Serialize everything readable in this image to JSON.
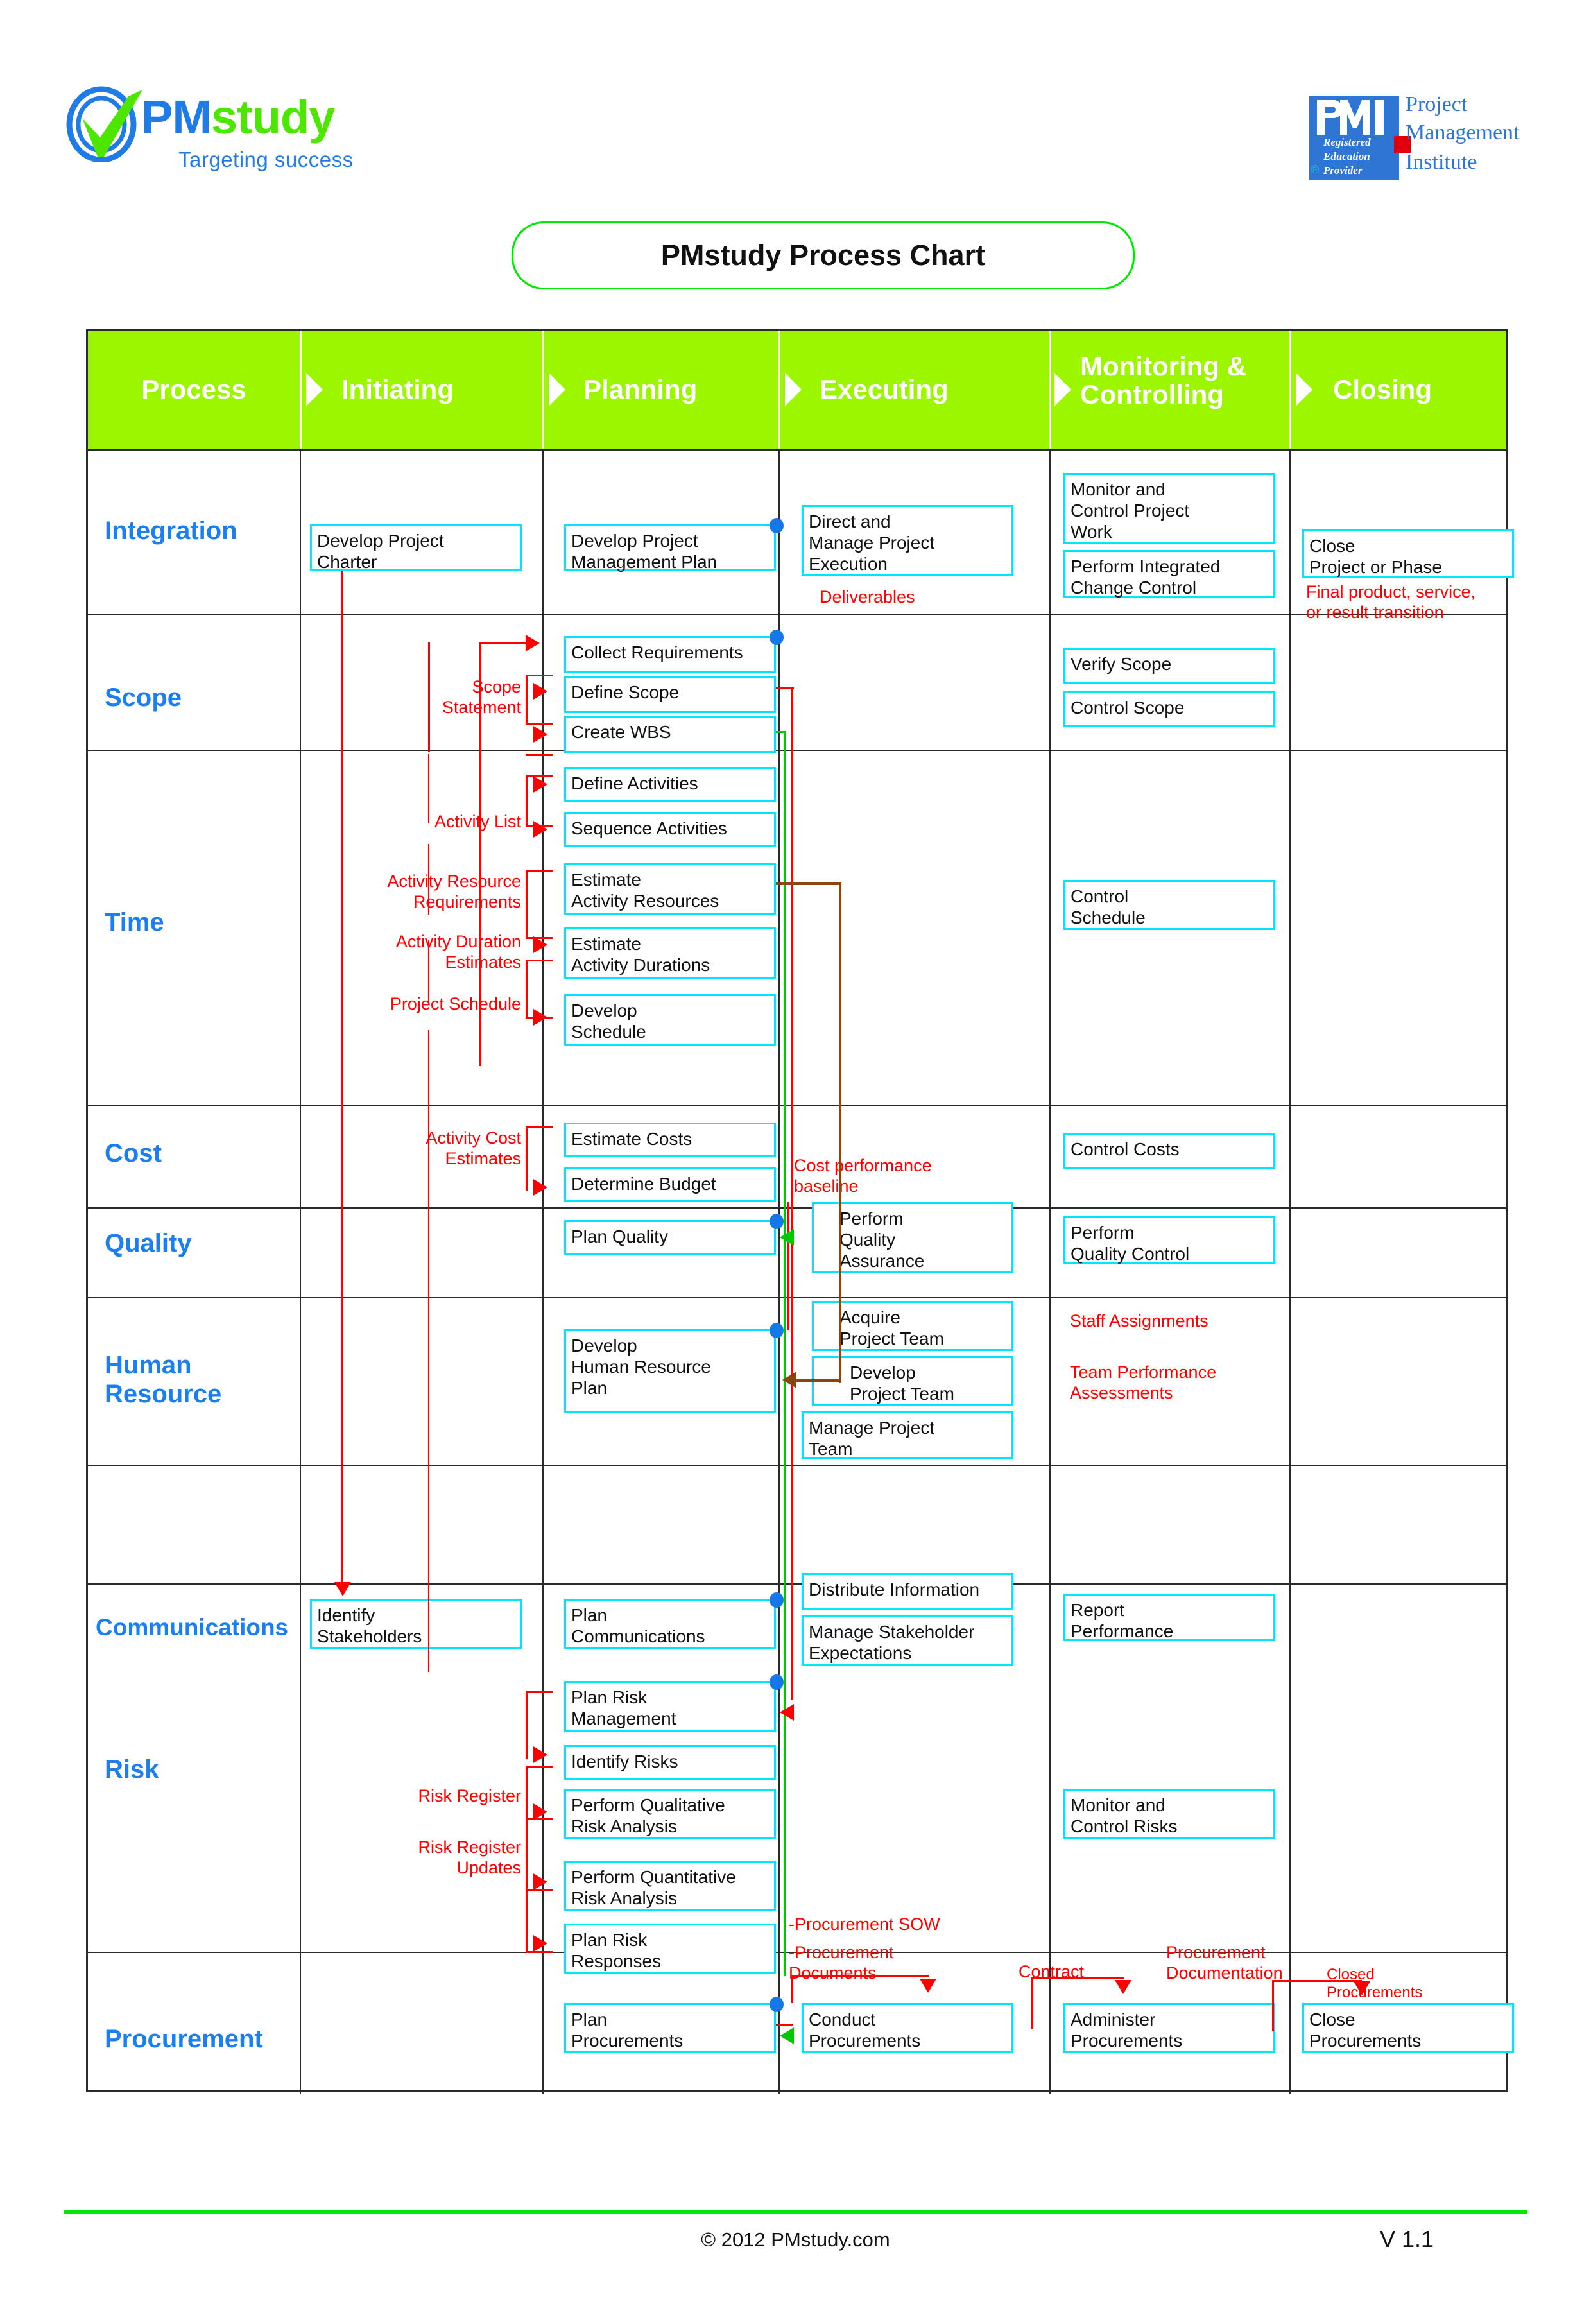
{
  "brand": {
    "logo_word_pm": "PM",
    "logo_word_study": "study",
    "tagline": "Targeting success",
    "pmi_letters": "PMI",
    "pmi_sub_1": "Registered",
    "pmi_sub_2": "Education",
    "pmi_sub_3": "Provider",
    "pmi_reg_mark": "®",
    "pmi_name_1": "Project",
    "pmi_name_2": "Management",
    "pmi_name_3": "Institute"
  },
  "title": "PMstudy Process Chart",
  "colors": {
    "header_green": "#9CF600",
    "box_border": "#00E5FF",
    "row_label_blue": "#1B7FF0",
    "annotation_red": "#FF0000",
    "brand_blue": "#1F7BE5",
    "brand_green": "#4CE600"
  },
  "columns": [
    "Process",
    "Initiating",
    "Planning",
    "Executing",
    "Monitoring & Controlling",
    "Closing"
  ],
  "chart_data": {
    "type": "table",
    "title": "PMstudy Process Chart",
    "columns": [
      "Process",
      "Initiating",
      "Planning",
      "Executing",
      "Monitoring & Controlling",
      "Closing"
    ],
    "rows": [
      {
        "knowledge_area": "Integration",
        "initiating": [
          "Develop Project Charter"
        ],
        "planning": [
          "Develop Project Management Plan"
        ],
        "executing": [
          "Direct and Manage Project Execution"
        ],
        "monitoring": [
          "Monitor and Control Project Work",
          "Perform Integrated Change Control"
        ],
        "closing": [
          "Close Project or Phase"
        ],
        "annotations": [
          "Deliverables",
          "Final product, service, or result transition"
        ]
      },
      {
        "knowledge_area": "Scope",
        "initiating": [],
        "planning": [
          "Collect Requirements",
          "Define Scope",
          "Create WBS"
        ],
        "executing": [],
        "monitoring": [
          "Verify Scope",
          "Control Scope"
        ],
        "closing": [],
        "annotations": [
          "Scope Statement"
        ]
      },
      {
        "knowledge_area": "Time",
        "initiating": [],
        "planning": [
          "Define Activities",
          "Sequence Activities",
          "Estimate Activity Resources",
          "Estimate Activity Durations",
          "Develop Schedule"
        ],
        "executing": [],
        "monitoring": [
          "Control Schedule"
        ],
        "closing": [],
        "annotations": [
          "Activity List",
          "Activity Resource Requirements",
          "Activity Duration Estimates",
          "Project Schedule"
        ]
      },
      {
        "knowledge_area": "Cost",
        "initiating": [],
        "planning": [
          "Estimate Costs",
          "Determine Budget"
        ],
        "executing": [],
        "monitoring": [
          "Control Costs"
        ],
        "closing": [],
        "annotations": [
          "Activity Cost Estimates",
          "Cost performance baseline"
        ]
      },
      {
        "knowledge_area": "Quality",
        "initiating": [],
        "planning": [
          "Plan Quality"
        ],
        "executing": [
          "Perform Quality Assurance"
        ],
        "monitoring": [
          "Perform Quality Control"
        ],
        "closing": [],
        "annotations": []
      },
      {
        "knowledge_area": "Human Resource",
        "initiating": [],
        "planning": [
          "Develop Human Resource Plan"
        ],
        "executing": [
          "Acquire Project Team",
          "Develop Project Team",
          "Manage Project Team"
        ],
        "monitoring": [],
        "closing": [],
        "annotations": [
          "Staff Assignments",
          "Team Performance Assessments"
        ]
      },
      {
        "knowledge_area": "Communications",
        "initiating": [
          "Identify Stakeholders"
        ],
        "planning": [
          "Plan Communications"
        ],
        "executing": [
          "Distribute Information",
          "Manage Stakeholder Expectations"
        ],
        "monitoring": [
          "Report Performance"
        ],
        "closing": [],
        "annotations": []
      },
      {
        "knowledge_area": "Risk",
        "initiating": [],
        "planning": [
          "Plan Risk Management",
          "Identify Risks",
          "Perform Qualitative Risk Analysis",
          "Perform Quantitative Risk Analysis",
          "Plan Risk Responses"
        ],
        "executing": [],
        "monitoring": [
          "Monitor and Control Risks"
        ],
        "closing": [],
        "annotations": [
          "Risk Register",
          "Risk Register Updates"
        ]
      },
      {
        "knowledge_area": "Procurement",
        "initiating": [],
        "planning": [
          "Plan Procurements"
        ],
        "executing": [
          "Conduct Procurements"
        ],
        "monitoring": [
          "Administer Procurements"
        ],
        "closing": [
          "Close Procurements"
        ],
        "annotations": [
          "-Procurement SOW",
          "-Procurement Documents",
          "Contract",
          "Procurement Documentation",
          "Closed Procurements"
        ]
      }
    ]
  },
  "rows": {
    "integration": {
      "label": "Integration",
      "develop_project_charter": "Develop Project\nCharter",
      "develop_pm_plan": "Develop Project\nManagement Plan",
      "direct_manage": "Direct and\nManage Project\nExecution",
      "monitor_control_work": "Monitor and\nControl Project\nWork",
      "perform_integrated_change": "Perform Integrated\nChange Control",
      "close_project": "Close\nProject or Phase",
      "deliverables": "Deliverables",
      "final_product": "Final product, service,\nor result transition"
    },
    "scope": {
      "label": "Scope",
      "collect_requirements": "Collect Requirements",
      "define_scope": "Define Scope",
      "create_wbs": "Create WBS",
      "verify_scope": "Verify Scope",
      "control_scope": "Control Scope",
      "scope_statement": "Scope\nStatement"
    },
    "time": {
      "label": "Time",
      "define_activities": "Define Activities",
      "sequence_activities": "Sequence Activities",
      "estimate_activity_resources": "Estimate\nActivity Resources",
      "estimate_activity_durations": "Estimate\nActivity Durations",
      "develop_schedule": "Develop\nSchedule",
      "control_schedule": "Control\nSchedule",
      "activity_list": "Activity List",
      "activity_resource_requirements": "Activity Resource\nRequirements",
      "activity_duration_estimates": "Activity Duration\nEstimates",
      "project_schedule": "Project Schedule"
    },
    "cost": {
      "label": "Cost",
      "estimate_costs": "Estimate Costs",
      "determine_budget": "Determine Budget",
      "control_costs": "Control Costs",
      "activity_cost_estimates": "Activity Cost\nEstimates",
      "cost_performance_baseline": "Cost performance\nbaseline"
    },
    "quality": {
      "label": "Quality",
      "plan_quality": "Plan Quality",
      "perform_quality_assurance": "Perform\nQuality\nAssurance",
      "perform_quality_control": "Perform\nQuality Control"
    },
    "human_resource": {
      "label": "Human\nResource",
      "develop_hr_plan": "Develop\nHuman Resource\nPlan",
      "acquire_project_team": "Acquire\nProject Team",
      "develop_project_team": "Develop\nProject Team",
      "manage_project_team": "Manage Project\nTeam",
      "staff_assignments": "Staff Assignments",
      "team_performance_assessments": "Team Performance\nAssessments"
    },
    "communications": {
      "label": "Communications",
      "identify_stakeholders": "Identify\nStakeholders",
      "plan_communications": "Plan\nCommunications",
      "distribute_information": "Distribute Information",
      "manage_stakeholder_expectations": "Manage Stakeholder\nExpectations",
      "report_performance": "Report\nPerformance"
    },
    "risk": {
      "label": "Risk",
      "plan_risk_management": "Plan Risk\nManagement",
      "identify_risks": "Identify Risks",
      "perform_qualitative": "Perform Qualitative\nRisk Analysis",
      "perform_quantitative": "Perform Quantitative\nRisk Analysis",
      "plan_risk_responses": "Plan Risk\nResponses",
      "monitor_control_risks": "Monitor and\nControl Risks",
      "risk_register": "Risk Register",
      "risk_register_updates": "Risk Register\nUpdates"
    },
    "procurement": {
      "label": "Procurement",
      "plan_procurements": "Plan\nProcurements",
      "conduct_procurements": "Conduct\nProcurements",
      "administer_procurements": "Administer\nProcurements",
      "close_procurements": "Close\nProcurements",
      "procurement_sow": "-Procurement SOW",
      "procurement_documents": "-Procurement\nDocuments",
      "contract": "Contract",
      "procurement_documentation": "Procurement\nDocumentation",
      "closed_procurements": "Closed\nProcurements"
    }
  },
  "footer": {
    "copyright": "© 2012 PMstudy.com",
    "version": "V 1.1"
  }
}
